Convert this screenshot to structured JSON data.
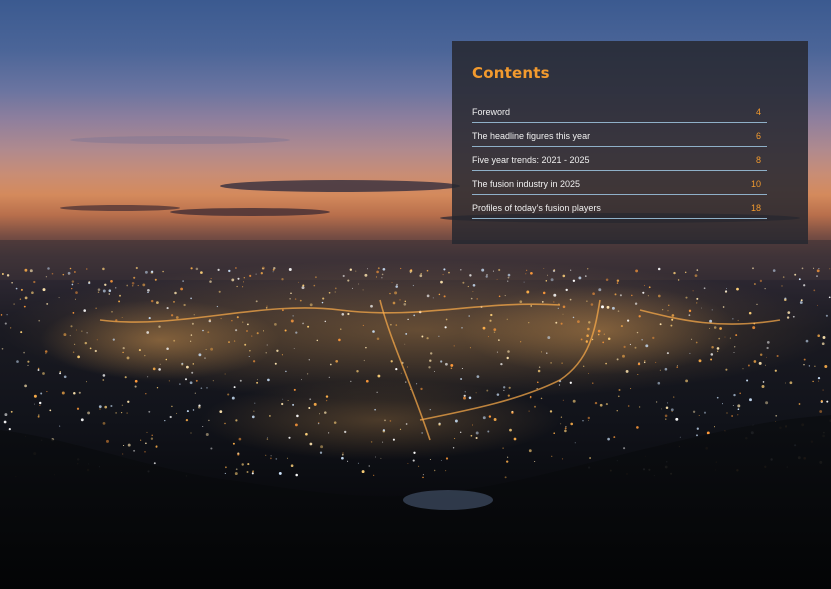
{
  "colors": {
    "accent": "#f29a2e",
    "rule": "#8fb0c8",
    "panel": "#26282f"
  },
  "contents": {
    "title": "Contents",
    "items": [
      {
        "label": "Foreword",
        "page": "4"
      },
      {
        "label": "The headline figures this year",
        "page": "6"
      },
      {
        "label": "Five year trends: 2021 - 2025",
        "page": "8"
      },
      {
        "label": "The fusion industry in 2025",
        "page": "10"
      },
      {
        "label": "Profiles of today’s fusion players",
        "page": "18"
      }
    ]
  },
  "background": {
    "subject": "night-city-skyline-photo"
  }
}
